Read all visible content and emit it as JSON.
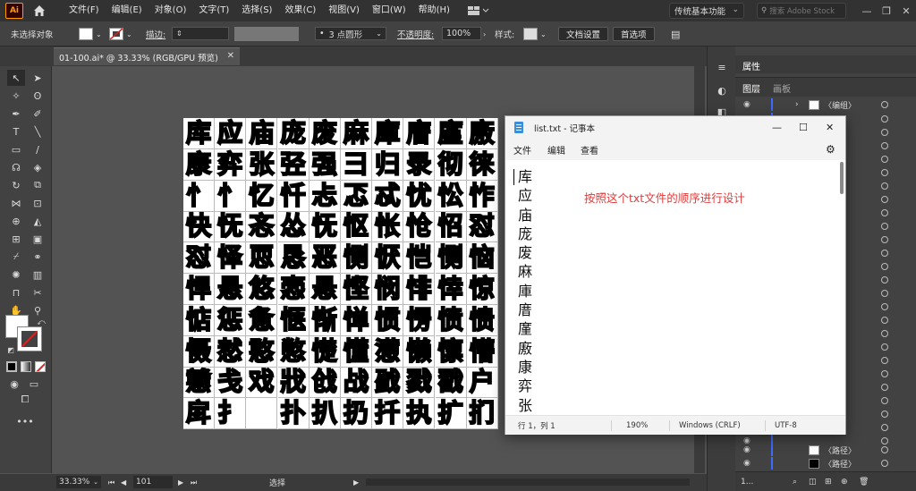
{
  "menubar": {
    "logo": "Ai",
    "items": [
      "文件(F)",
      "编辑(E)",
      "对象(O)",
      "文字(T)",
      "选择(S)",
      "效果(C)",
      "视图(V)",
      "窗口(W)",
      "帮助(H)"
    ],
    "workspace": "传统基本功能",
    "stock_search_placeholder": "搜索 Adobe Stock"
  },
  "controlbar": {
    "selection_status": "未选择对象",
    "stroke_label": "描边:",
    "brush_value": "3 点圆形",
    "opacity_label": "不透明度:",
    "opacity_value": "100%",
    "style_label": "样式:",
    "doc_setup_label": "文档设置",
    "preferences_label": "首选项"
  },
  "document": {
    "tab_title": "01-100.ai* @ 33.33% (RGB/GPU 预览)",
    "zoom": "33.33%",
    "artboard_number": "101",
    "status_tool": "选择"
  },
  "artboard_glyphs": [
    "库",
    "应",
    "庙",
    "庞",
    "废",
    "麻",
    "庫",
    "庴",
    "廑",
    "廒",
    "康",
    "弈",
    "张",
    "弪",
    "强",
    "彐",
    "归",
    "录",
    "彻",
    "徕",
    "忄",
    "忄",
    "忆",
    "忏",
    "忐",
    "忑",
    "忒",
    "忧",
    "忪",
    "怍",
    "快",
    "怃",
    "忞",
    "怂",
    "怃",
    "怄",
    "怅",
    "怆",
    "怊",
    "怼",
    "怼",
    "怿",
    "恧",
    "恳",
    "恶",
    "恻",
    "恹",
    "恺",
    "恻",
    "恼",
    "悍",
    "悬",
    "悠",
    "悫",
    "悬",
    "悭",
    "悯",
    "悱",
    "悻",
    "惊",
    "惦",
    "惩",
    "惫",
    "惬",
    "惭",
    "惮",
    "惯",
    "愣",
    "愤",
    "愦",
    "慑",
    "慭",
    "憨",
    "憋",
    "憷",
    "懂",
    "懑",
    "懒",
    "懔",
    "懵",
    "戆",
    "戋",
    "戏",
    "戕",
    "戗",
    "战",
    "戤",
    "戮",
    "戳",
    "户",
    "戽",
    "扌",
    "",
    "扑",
    "扒",
    "扔",
    "扦",
    "执",
    "扩",
    "扪"
  ],
  "properties_panel": {
    "tab_properties": "属性",
    "tab_layers": "图层",
    "tab_artboards": "画板",
    "layers": [
      {
        "name": "〈编组〉"
      },
      {
        "name": "〈路径〉"
      },
      {
        "name": "〈路径〉"
      },
      {
        "name": "〈路径〉"
      }
    ],
    "layer_count": "1..."
  },
  "notepad": {
    "title": "list.txt - 记事本",
    "menu": [
      "文件",
      "编辑",
      "查看"
    ],
    "lines": [
      "库",
      "应",
      "庙",
      "庞",
      "废",
      "麻",
      "庫",
      "庴",
      "廑",
      "廒",
      "康",
      "弈",
      "张"
    ],
    "annotation": "按照这个txt文件的顺序进行设计",
    "status": {
      "position": "行 1，列 1",
      "zoom": "190%",
      "line_ending": "Windows (CRLF)",
      "encoding": "UTF-8"
    }
  }
}
